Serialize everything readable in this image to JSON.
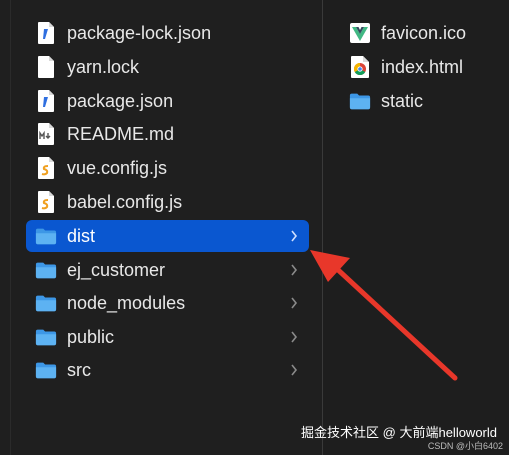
{
  "left_column": {
    "items": [
      {
        "label": "package-lock.json",
        "icon": "json-file-icon"
      },
      {
        "label": "yarn.lock",
        "icon": "text-file-icon"
      },
      {
        "label": "package.json",
        "icon": "json-file-icon"
      },
      {
        "label": "README.md",
        "icon": "markdown-file-icon"
      },
      {
        "label": "vue.config.js",
        "icon": "js-file-icon"
      },
      {
        "label": "babel.config.js",
        "icon": "js-file-icon"
      },
      {
        "label": "dist",
        "icon": "folder-icon",
        "selected": true
      },
      {
        "label": "ej_customer",
        "icon": "folder-icon"
      },
      {
        "label": "node_modules",
        "icon": "folder-icon"
      },
      {
        "label": "public",
        "icon": "folder-icon"
      },
      {
        "label": "src",
        "icon": "folder-icon"
      }
    ]
  },
  "right_column": {
    "items": [
      {
        "label": "favicon.ico",
        "icon": "vue-favicon-icon"
      },
      {
        "label": "index.html",
        "icon": "chrome-html-icon"
      },
      {
        "label": "static",
        "icon": "folder-icon"
      }
    ]
  },
  "watermark": {
    "main": "掘金技术社区 @ 大前端helloworld",
    "sub": "CSDN @小白6402"
  },
  "colors": {
    "selection": "#0a57d0",
    "folder": "#4aa3ec",
    "arrow": "#e8372a"
  }
}
